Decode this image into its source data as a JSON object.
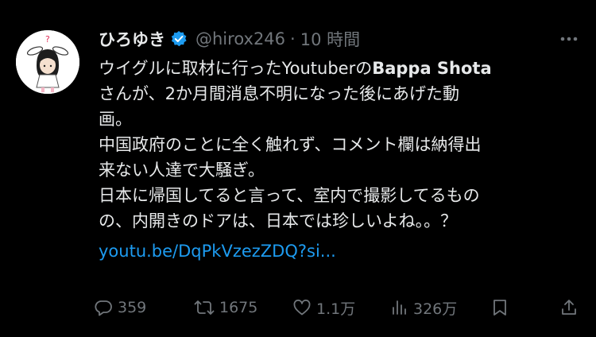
{
  "tweet": {
    "author_name": "ひろゆき",
    "handle": "@hirox246",
    "separator": "·",
    "time": "10 時間",
    "body": {
      "line1_a": "ウイグルに取材に行ったYoutuberの",
      "line1_bold": "Bappa Shota",
      "line2": "さんが、2か月間消息不明になった後にあげた動",
      "line3": "画。",
      "line4": "中国政府のことに全く触れず、コメント欄は納得出",
      "line5": "来ない人達で大騒ぎ。",
      "line6": "日本に帰国してると言って、室内で撮影してるもの",
      "line7": "の、内開きのドアは、日本では珍しいよね。。？",
      "link": "youtu.be/DqPkVzezZDQ?si..."
    },
    "actions": {
      "replies": "359",
      "retweets": "1675",
      "likes": "1.1万",
      "views": "326万"
    }
  },
  "colors": {
    "background": "#000000",
    "text": "#e7e9ea",
    "muted": "#71767b",
    "link": "#1d9bf0",
    "verified": "#1d9bf0"
  },
  "icons": [
    "avatar",
    "verified-badge-icon",
    "more-icon",
    "reply-icon",
    "retweet-icon",
    "like-icon",
    "views-icon",
    "bookmark-icon",
    "share-icon"
  ]
}
